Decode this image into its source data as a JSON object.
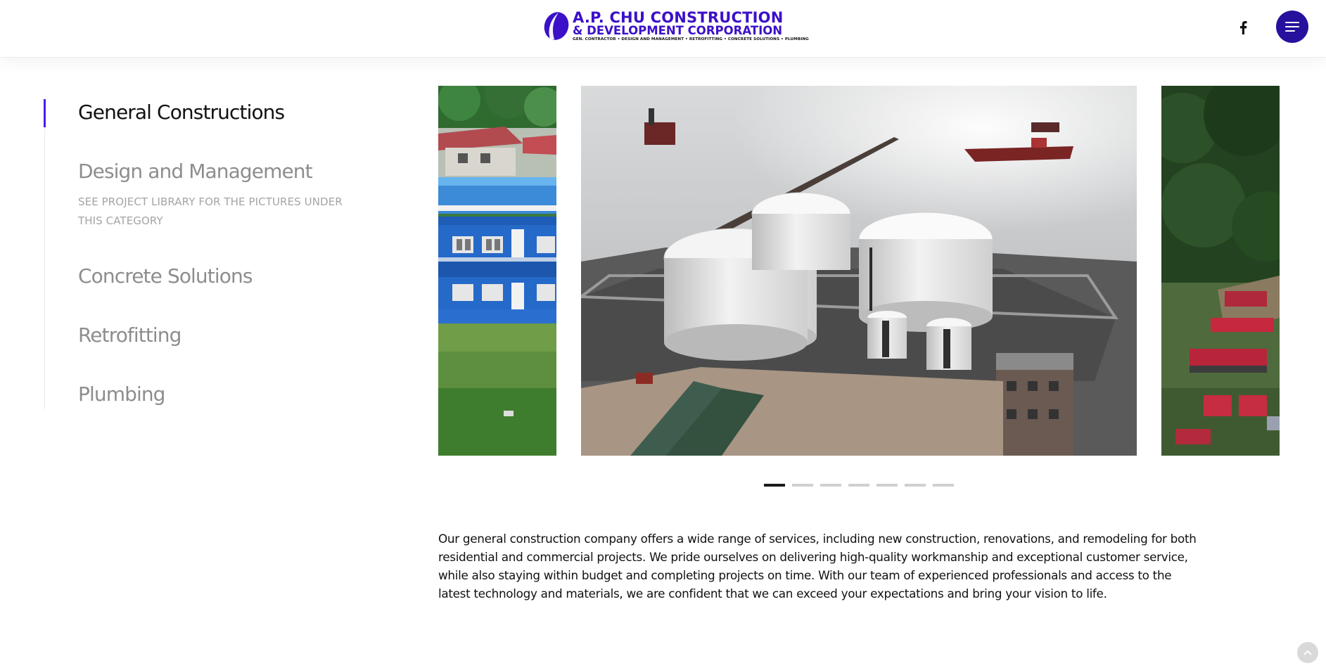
{
  "header": {
    "logo_line1": "A.P. CHU CONSTRUCTION",
    "logo_line2": "& DEVELOPMENT CORPORATION",
    "logo_line3": "GEN. CONTRACTOR • DESIGN AND MANAGEMENT • RETROFITTING • CONCRETE SOLUTIONS • PLUMBING",
    "facebook_icon": "facebook-icon",
    "menu_icon": "hamburger-menu-icon",
    "brand_color": "#3b10c8",
    "menu_button_color": "#25119e"
  },
  "tabs": {
    "accent_color": "#4a1df0",
    "items": [
      {
        "label": "General Constructions",
        "active": true
      },
      {
        "label": "Design and Management",
        "active": false,
        "sub": "SEE PROJECT LIBRARY FOR THE PICTURES UNDER THIS CATEGORY"
      },
      {
        "label": "Concrete Solutions",
        "active": false
      },
      {
        "label": "Retrofitting",
        "active": false
      },
      {
        "label": "Plumbing",
        "active": false
      }
    ]
  },
  "carousel": {
    "slides": [
      {
        "subject": "blue two-storey school building"
      },
      {
        "subject": "aerial view of oil storage tanks by the sea"
      },
      {
        "subject": "aerial view of red-roofed housing among trees"
      }
    ],
    "total_slides": 7,
    "active_index": 0
  },
  "description": {
    "text": "Our general construction company offers a wide range of services, including new construction, renovations, and remodeling for both residential and commercial projects. We pride ourselves on delivering high-quality workmanship and exceptional customer service, while also staying within budget and completing projects on time. With our team of experienced professionals and access to the latest technology and materials, we are confident that we can exceed your expectations and bring your vision to life."
  },
  "back_to_top_icon": "chevron-up-icon"
}
